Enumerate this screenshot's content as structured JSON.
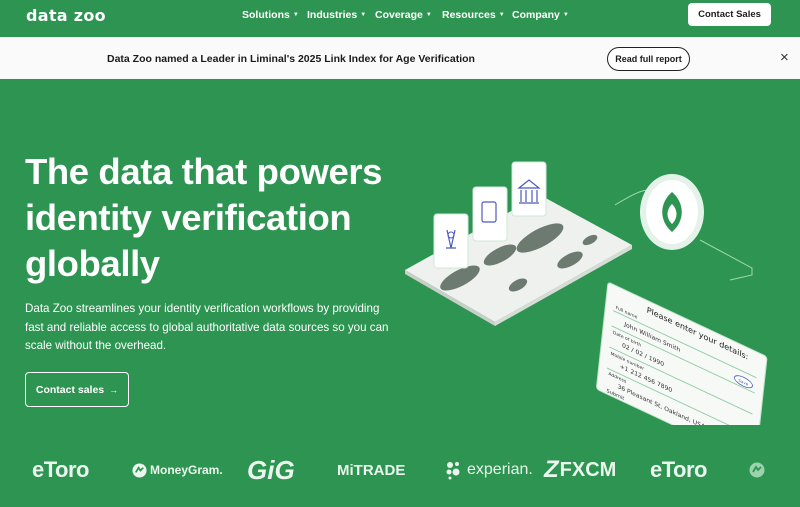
{
  "nav": {
    "logo": "data zoo",
    "menu": [
      "Solutions",
      "Industries",
      "Coverage",
      "Resources",
      "Company"
    ],
    "cta": "Contact Sales"
  },
  "banner": {
    "text": "Data Zoo named a Leader in Liminal's 2025 Link Index for Age Verification",
    "button": "Read full report",
    "close": "×"
  },
  "hero": {
    "title": "The data that powers identity verification globally",
    "description": "Data Zoo streamlines your identity verification workflows by providing fast and reliable access to global authoritative data sources so you can scale without the overhead.",
    "cta": "Contact sales",
    "cta_arrow": "→"
  },
  "form_card": {
    "heading": "Please enter your details:",
    "fields": [
      {
        "label": "Full name",
        "value": "John William Smith"
      },
      {
        "label": "Date of birth",
        "value": "02 / 02 / 1990"
      },
      {
        "label": "Mobile number",
        "value": "+1 212 456 7890"
      },
      {
        "label": "Address",
        "value": "36 Pleasant St, Oakland, USA"
      }
    ],
    "submit": "Submit",
    "badge": "Save"
  },
  "logos": [
    "eToro",
    "MoneyGram.",
    "GiG",
    "MiTRADE",
    "experian.",
    "FXCM",
    "eToro"
  ],
  "colors": {
    "brand_green": "#2d9451",
    "banner_bg": "#fafafa",
    "white": "#ffffff"
  }
}
